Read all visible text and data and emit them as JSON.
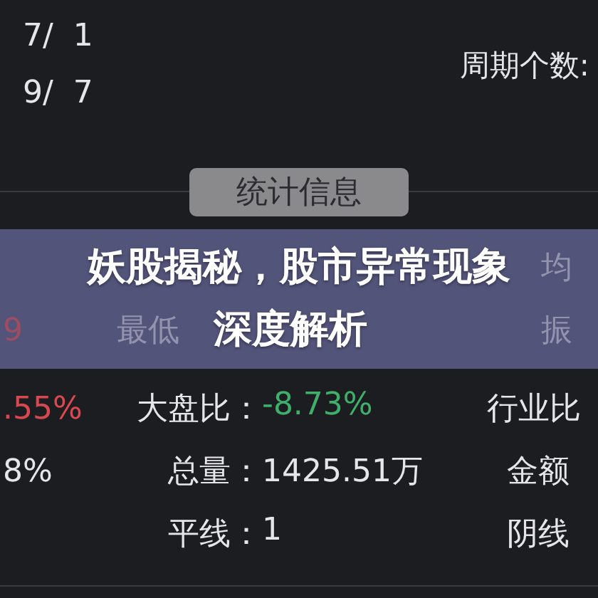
{
  "period_rows": [
    "7/  1",
    "9/  7"
  ],
  "period_count_label": "周期个数:",
  "tab": {
    "label": "统计信息",
    "selected": true
  },
  "banner": {
    "title_lines": [
      "妖股揭秘，股市异常现象",
      "深度解析"
    ],
    "upper_right": "均",
    "lower_left": {
      "text": "9",
      "kind": "rise"
    },
    "lower_mid": "最低",
    "lower_right": "振"
  },
  "stats_rows": [
    {
      "left": {
        "text": ".55%",
        "kind": "rise"
      },
      "label": "大盘比：",
      "value": {
        "text": "-8.73%",
        "kind": "fall"
      },
      "right": "行业比"
    },
    {
      "left": {
        "text": "8%",
        "kind": "plain"
      },
      "label": "总量：",
      "value": {
        "text": "1425.51万",
        "kind": "plain"
      },
      "right": "金额"
    },
    {
      "label": "平线：",
      "value": {
        "text": "1",
        "kind": "plain"
      },
      "right": "阴线"
    }
  ]
}
